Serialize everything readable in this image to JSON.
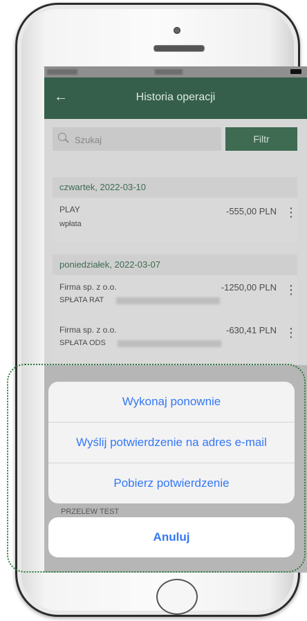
{
  "header": {
    "title": "Historia operacji"
  },
  "search": {
    "placeholder": "Szukaj",
    "filter_label": "Filtr"
  },
  "sections": [
    {
      "date": "czwartek, 2022-03-10",
      "items": [
        {
          "name": "PLAY",
          "desc": "wpłata",
          "amount": "-555,00 PLN"
        }
      ]
    },
    {
      "date": "poniedziałek, 2022-03-07",
      "items": [
        {
          "name": "Firma sp. z o.o.",
          "desc": "SPŁATA RAT",
          "amount": "-1250,00 PLN"
        },
        {
          "name": "Firma sp. z o.o.",
          "desc": "SPŁATA ODS",
          "amount": "-630,41 PLN"
        }
      ]
    }
  ],
  "peek_text": "PRZELEW TEST",
  "action_sheet": {
    "options": [
      "Wykonaj ponownie",
      "Wyślij potwierdzenie na adres e-mail",
      "Pobierz potwierdzenie"
    ],
    "cancel": "Anuluj"
  },
  "colors": {
    "accent": "#355f4a",
    "action_blue": "#3478f6",
    "highlight_outline": "#2e7a3e"
  }
}
